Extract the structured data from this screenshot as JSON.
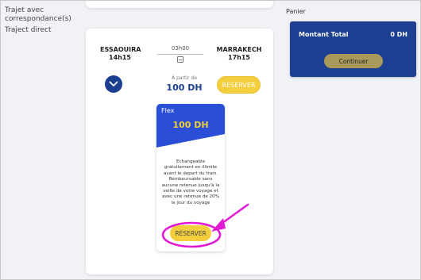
{
  "filters": {
    "options": [
      "Trajet avec correspondance(s)",
      "Traject direct"
    ]
  },
  "trip": {
    "departure": {
      "station": "ESSAOUIRA",
      "time": "14h15"
    },
    "arrival": {
      "station": "MARRAKECH",
      "time": "17h15"
    },
    "duration": "03h00",
    "price_from_label": "À partir de",
    "price_from": "100 DH",
    "reserve_label": "RÉSERVER"
  },
  "fare": {
    "name": "Flex",
    "price": "100 DH",
    "description": "Echangeable gratuitement en illimite avant le depart du train. Remboursable sans aucune retenue jusqu'à la veille de votre voyage et avec une retenue de 20% le jour du voyage",
    "reserve_label": "RÉSERVER"
  },
  "cart": {
    "title": "Panier",
    "total_label": "Montant Total",
    "total_value": "0 DH",
    "continue_label": "Continuer"
  },
  "colors": {
    "brand_blue": "#1d3f91",
    "accent_yellow": "#f3cf3d",
    "annotation_magenta": "#e21bd3"
  }
}
